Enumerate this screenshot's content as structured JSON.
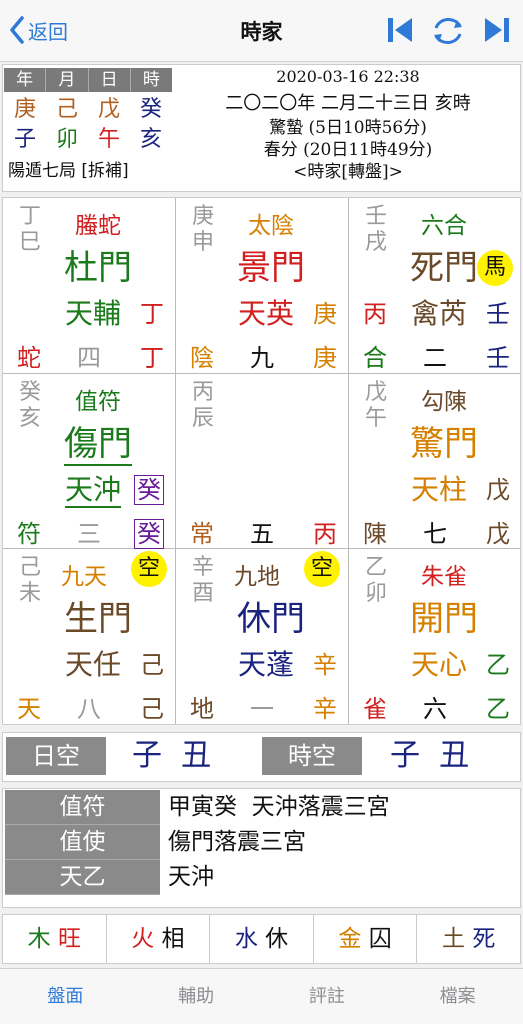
{
  "nav": {
    "back_label": "返回",
    "title": "時家"
  },
  "pillars": {
    "headers": [
      "年",
      "月",
      "日",
      "時"
    ],
    "gan": [
      "庚",
      "己",
      "戊",
      "癸"
    ],
    "zhi": [
      "子",
      "卯",
      "午",
      "亥"
    ],
    "ju": "陽遁七局 [拆補]"
  },
  "info": {
    "datetime": "2020-03-16 22:38",
    "lunar": "二〇二〇年 二月二十三日 亥時",
    "term1": "驚蟄 (5日10時56分)",
    "term2": "春分 (20日11時49分)",
    "mode": "<時家[轉盤]>"
  },
  "palaces": [
    {
      "gan": "丁巳",
      "deity": "螣蛇",
      "men": "杜門",
      "xing": "天輔",
      "xing_gan": "丁",
      "b1": "蛇",
      "b2": "四",
      "b3": "丁"
    },
    {
      "gan": "庚申",
      "deity": "太陰",
      "men": "景門",
      "xing": "天英",
      "xing_gan": "庚",
      "b1": "陰",
      "b2": "九",
      "b3": "庚"
    },
    {
      "gan": "壬戌",
      "deity": "六合",
      "men": "死門",
      "xing": "禽芮",
      "xing_gan": "壬",
      "left_gan": "丙",
      "badge": "馬",
      "b1": "合",
      "b2": "二",
      "b3": "壬"
    },
    {
      "gan": "癸亥",
      "deity": "值符",
      "men": "傷門",
      "xing": "天沖",
      "xing_gan": "癸",
      "b1": "符",
      "b2": "三",
      "b3": "癸"
    },
    {
      "gan": "丙辰",
      "b1": "常",
      "b2": "五",
      "b3": "丙"
    },
    {
      "gan": "戊午",
      "deity": "勾陳",
      "men": "驚門",
      "xing": "天柱",
      "xing_gan": "戊",
      "b1": "陳",
      "b2": "七",
      "b3": "戊"
    },
    {
      "gan": "己未",
      "deity": "九天",
      "men": "生門",
      "xing": "天任",
      "xing_gan": "己",
      "badge": "空",
      "b1": "天",
      "b2": "八",
      "b3": "己"
    },
    {
      "gan": "辛酉",
      "deity": "九地",
      "men": "休門",
      "xing": "天蓬",
      "xing_gan": "辛",
      "badge": "空",
      "b1": "地",
      "b2": "一",
      "b3": "辛"
    },
    {
      "gan": "乙卯",
      "deity": "朱雀",
      "men": "開門",
      "xing": "天心",
      "xing_gan": "乙",
      "b1": "雀",
      "b2": "六",
      "b3": "乙"
    }
  ],
  "kong": {
    "day_label": "日空",
    "day_value": "子  丑",
    "hour_label": "時空",
    "hour_value": "子  丑"
  },
  "details": [
    {
      "label": "值符",
      "value": "甲寅癸  天沖落震三宮"
    },
    {
      "label": "值使",
      "value": "傷門落震三宮"
    },
    {
      "label": "天乙",
      "value": "天沖"
    }
  ],
  "wuxing": [
    {
      "el": "木",
      "state": "旺"
    },
    {
      "el": "火",
      "state": "相"
    },
    {
      "el": "水",
      "state": "休"
    },
    {
      "el": "金",
      "state": "囚"
    },
    {
      "el": "土",
      "state": "死"
    }
  ],
  "tabs": [
    "盤面",
    "輔助",
    "評註",
    "檔案"
  ],
  "colors": {
    "accent": "#2f7ad7",
    "badge": "#fff200"
  }
}
